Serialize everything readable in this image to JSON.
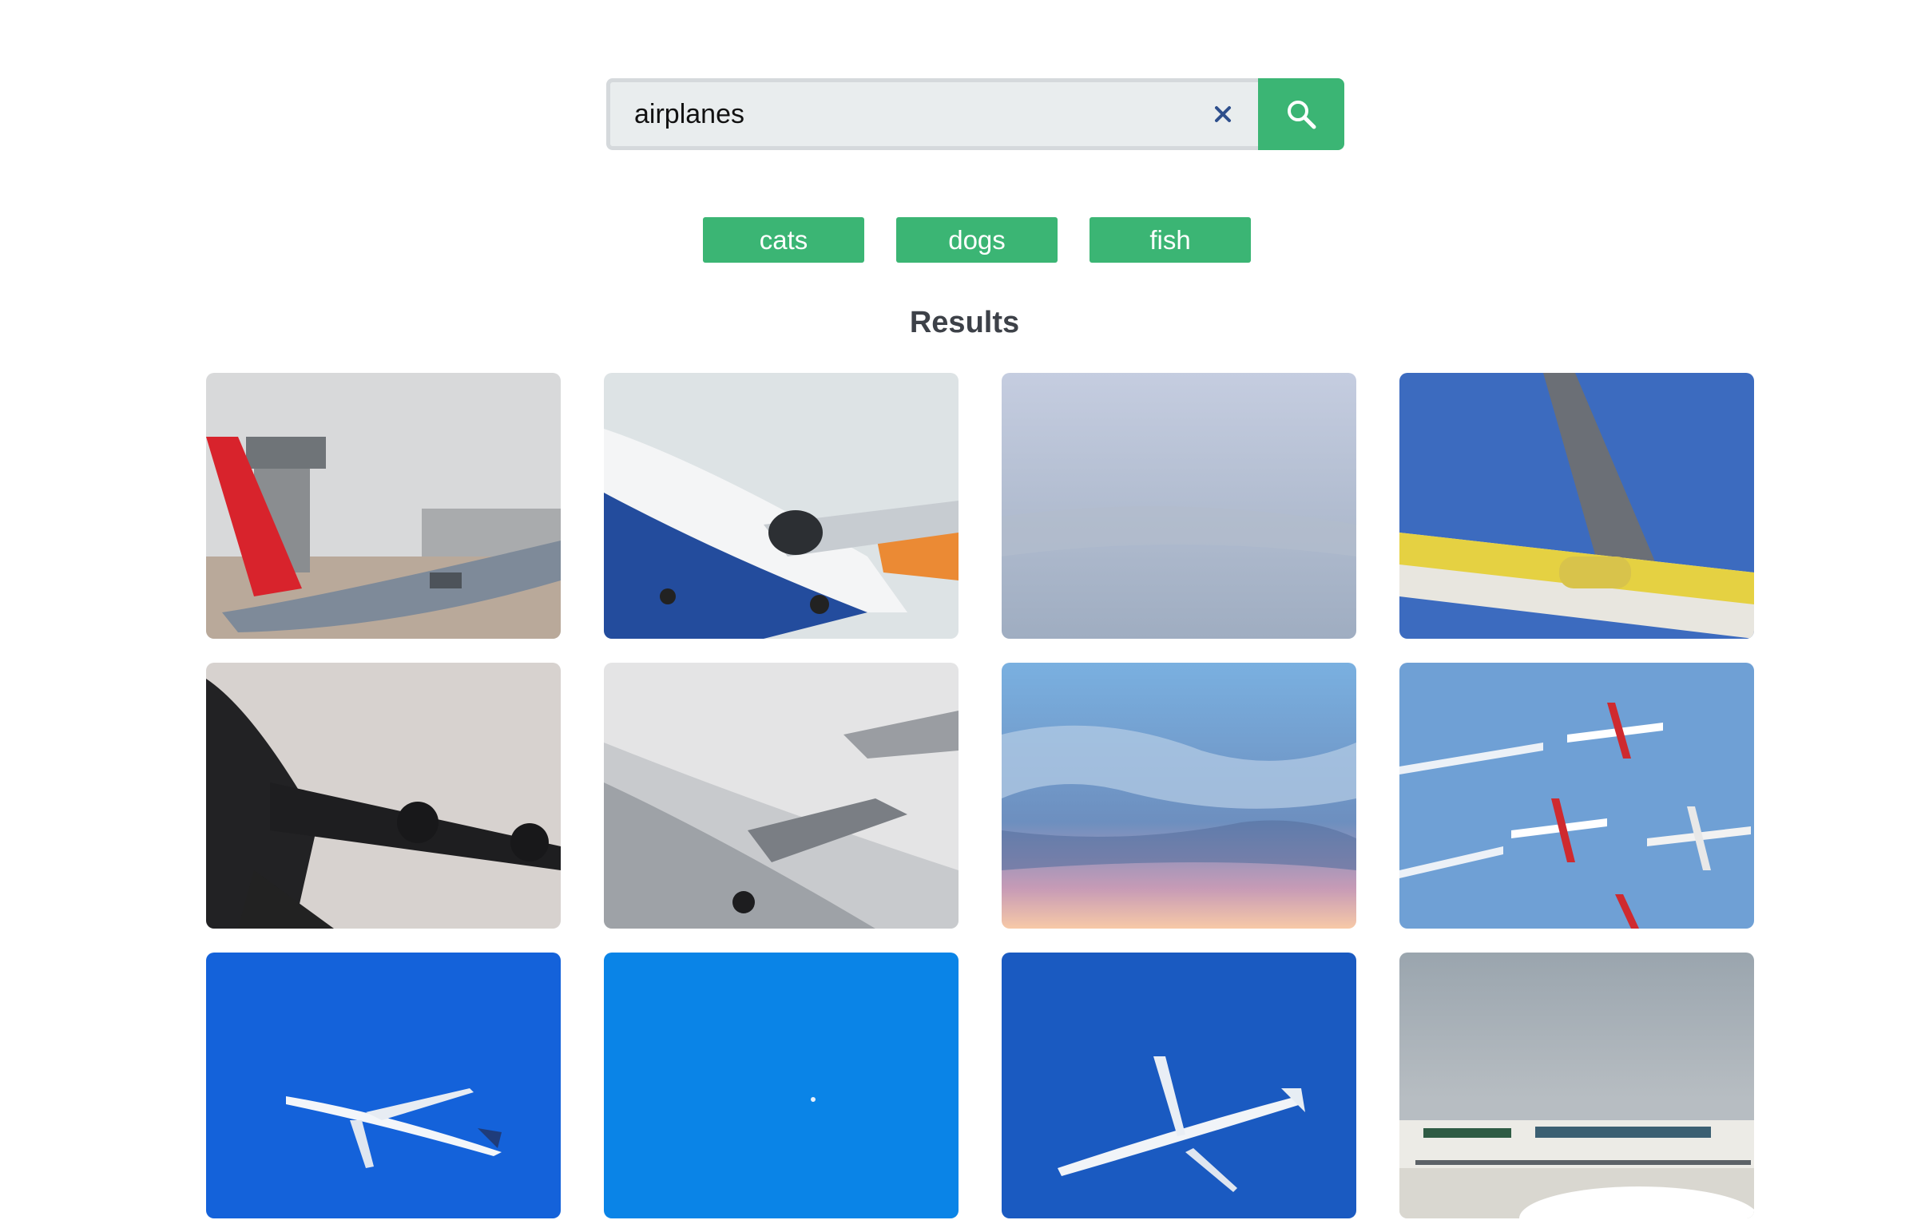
{
  "search": {
    "value": "airplanes",
    "placeholder": "",
    "clear_icon": "close-icon",
    "submit_icon": "search-icon"
  },
  "suggestions": [
    {
      "label": "cats"
    },
    {
      "label": "dogs"
    },
    {
      "label": "fish"
    }
  ],
  "results": {
    "heading": "Results",
    "items": [
      {
        "subject": "red-tail jet taking off near control tower",
        "sky_color": "#d9dadb"
      },
      {
        "subject": "white jet with orange tail climbing",
        "sky_color": "#dbe1e3"
      },
      {
        "subject": "overcast sky",
        "sky_color": "#b9c3d4"
      },
      {
        "subject": "yellow jet underside against blue sky",
        "sky_color": "#3f6cc0"
      },
      {
        "subject": "dark silhouette jumbo jet",
        "sky_color": "#d7d2cf"
      },
      {
        "subject": "grey jet with T-tail climbing",
        "sky_color": "#e3e3e4"
      },
      {
        "subject": "clouds at sunset",
        "sky_color": "#6d9dd2"
      },
      {
        "subject": "red-white aerobatic jets formation",
        "sky_color": "#6e9fd4"
      },
      {
        "subject": "white jet on blue sky",
        "sky_color": "#1462da"
      },
      {
        "subject": "distant plane in clear blue sky",
        "sky_color": "#0a84e7"
      },
      {
        "subject": "white jet on deep blue sky",
        "sky_color": "#1a5ac1"
      },
      {
        "subject": "Saudia airliner on runway",
        "sky_color": "#9aa4ad"
      }
    ]
  },
  "colors": {
    "accent": "#3bb574",
    "heading": "#3d4148",
    "input_bg": "#e9edee",
    "clear_icon": "#2e4f8c"
  }
}
